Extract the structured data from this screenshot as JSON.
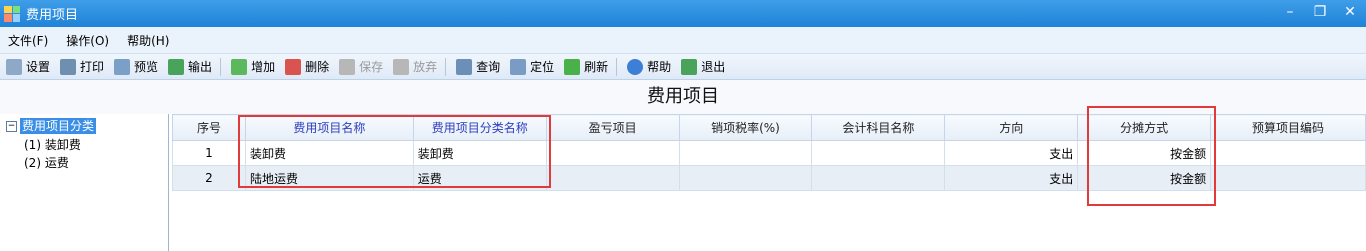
{
  "window": {
    "title": "费用项目"
  },
  "menus": [
    "文件(F)",
    "操作(O)",
    "帮助(H)"
  ],
  "toolbar": [
    {
      "label": "设置",
      "icon": "settings-icon",
      "color": "#8da9c7",
      "disabled": false
    },
    {
      "label": "打印",
      "icon": "printer-icon",
      "color": "#6f8fb0",
      "disabled": false
    },
    {
      "label": "预览",
      "icon": "preview-icon",
      "color": "#7aa0c8",
      "disabled": false
    },
    {
      "label": "输出",
      "icon": "export-icon",
      "color": "#4aa35a",
      "disabled": false
    },
    {
      "label": "增加",
      "icon": "add-icon",
      "color": "#5cb85c",
      "disabled": false
    },
    {
      "label": "删除",
      "icon": "delete-icon",
      "color": "#d9534f",
      "disabled": false
    },
    {
      "label": "保存",
      "icon": "save-icon",
      "color": "#b7b7b7",
      "disabled": true
    },
    {
      "label": "放弃",
      "icon": "discard-icon",
      "color": "#b7b7b7",
      "disabled": true
    },
    {
      "label": "查询",
      "icon": "query-icon",
      "color": "#6c8fb8",
      "disabled": false
    },
    {
      "label": "定位",
      "icon": "locate-icon",
      "color": "#7a9cc4",
      "disabled": false
    },
    {
      "label": "刷新",
      "icon": "refresh-icon",
      "color": "#4ab04a",
      "disabled": false
    },
    {
      "label": "帮助",
      "icon": "help-icon",
      "color": "#3d7fd6",
      "disabled": false
    },
    {
      "label": "退出",
      "icon": "exit-icon",
      "color": "#4aa35a",
      "disabled": false
    }
  ],
  "page_title": "费用项目",
  "tree": {
    "root": "费用项目分类",
    "children": [
      "(1) 装卸费",
      "(2) 运费"
    ]
  },
  "grid": {
    "headers": [
      "序号",
      "费用项目名称",
      "费用项目分类名称",
      "盈亏项目",
      "销项税率(%)",
      "会计科目名称",
      "方向",
      "分摊方式",
      "预算项目编码"
    ],
    "rows": [
      [
        "1",
        "装卸费",
        "装卸费",
        "",
        "",
        "",
        "支出",
        "按金额",
        ""
      ],
      [
        "2",
        "陆地运费",
        "运费",
        "",
        "",
        "",
        "支出",
        "按金额",
        ""
      ]
    ]
  },
  "colors": {
    "title_bar": "#1f82d8",
    "highlight_red": "#e23a3a",
    "header_blue_text": "#2e3ebd"
  }
}
